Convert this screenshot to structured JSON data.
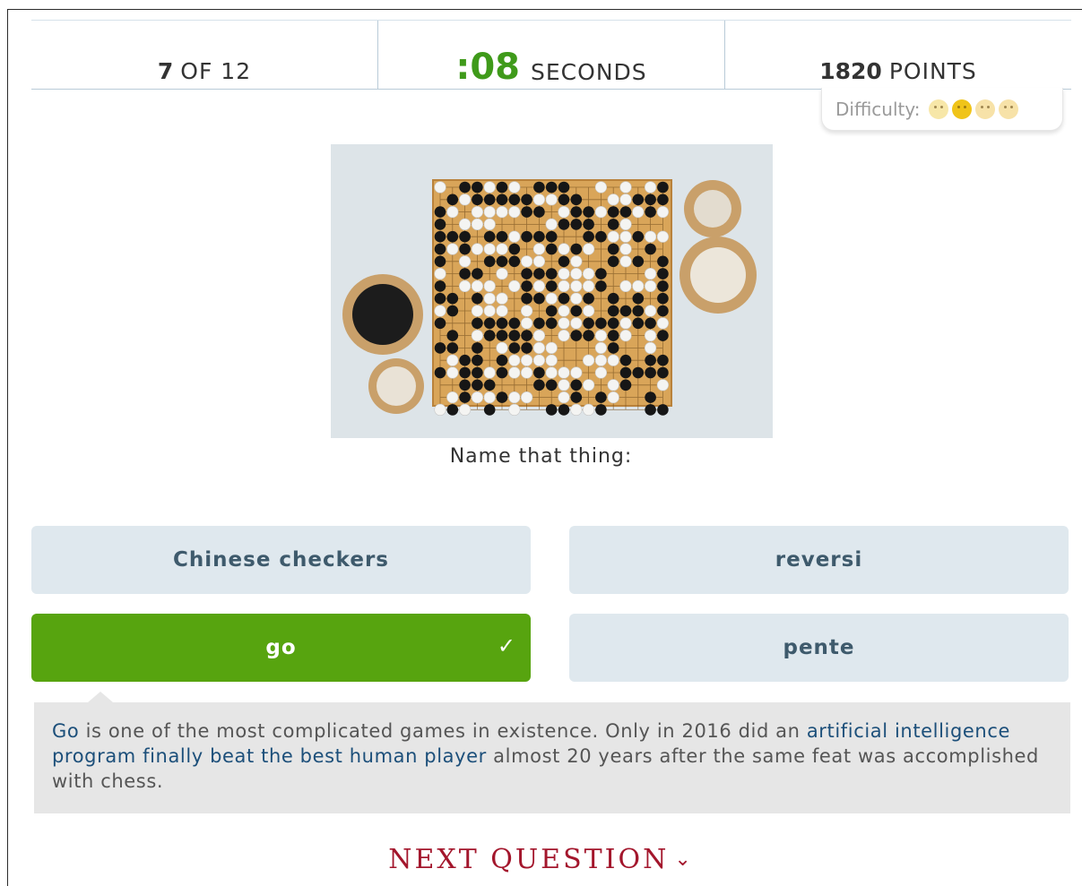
{
  "stats": {
    "progress_num": "7",
    "progress_unit": "of 12",
    "timer_num": ":08",
    "timer_unit": "seconds",
    "points_num": "1820",
    "points_unit": "points"
  },
  "difficulty": {
    "label": "Difficulty:",
    "faces": [
      "easy-face",
      "medium-face",
      "hard-face",
      "very-hard-face"
    ],
    "selected": "medium-face"
  },
  "question": {
    "image_alt": "go board with black and white stones and bowls",
    "prompt": "Name that thing:"
  },
  "answers": [
    {
      "label": "Chinese checkers",
      "state": "default"
    },
    {
      "label": "reversi",
      "state": "default"
    },
    {
      "label": "go",
      "state": "correct"
    },
    {
      "label": "pente",
      "state": "default"
    }
  ],
  "explanation": {
    "part1_link": "Go",
    "part2": " is one of the most complicated games in existence. Only in 2016 did an ",
    "part3_link": "artificial intelligence program finally beat the best human player",
    "part4": " almost 20 years after the same feat was accomplished with chess."
  },
  "next": {
    "label": "NEXT QUESTION",
    "icon": "chevron-down-icon"
  },
  "colors": {
    "timer": "#3f9a1a",
    "correct": "#57a40f",
    "answer_bg": "#dfe8ee",
    "next": "#a3162c",
    "link": "#1c4f7a"
  }
}
